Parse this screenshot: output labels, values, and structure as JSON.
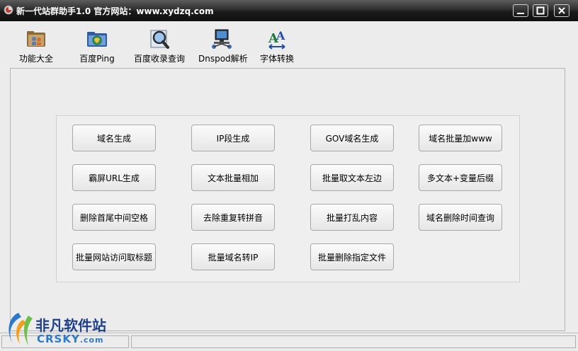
{
  "window": {
    "title": "新一代站群助手1.0  官方网站：www.xydzq.com"
  },
  "toolbar": {
    "items": [
      {
        "label": "功能大全",
        "icon": "folder-people-icon"
      },
      {
        "label": "百度Ping",
        "icon": "globe-folder-icon"
      },
      {
        "label": "百度收录查询",
        "icon": "magnifier-icon"
      },
      {
        "label": "Dnspod解析",
        "icon": "network-computer-icon"
      },
      {
        "label": "字体转换",
        "icon": "font-convert-icon"
      }
    ]
  },
  "functions": {
    "buttons": [
      "域名生成",
      "IP段生成",
      "GOV域名生成",
      "域名批量加www",
      "霸屏URL生成",
      "文本批量相加",
      "批量取文本左边",
      "多文本+变量后缀",
      "删除首尾中间空格",
      "去除重复转拼音",
      "批量打乱内容",
      "域名删除时间查询",
      "批量网站访问取标题",
      "批量域名转IP",
      "批量删除指定文件"
    ]
  },
  "watermark": {
    "line1": "非凡软件站",
    "line2": "CRSKY",
    "line2_suffix": ".com"
  },
  "colors": {
    "titlebar": "#1a1a1a",
    "window_bg": "#ececec",
    "watermark_blue": "#1e3f8a"
  }
}
